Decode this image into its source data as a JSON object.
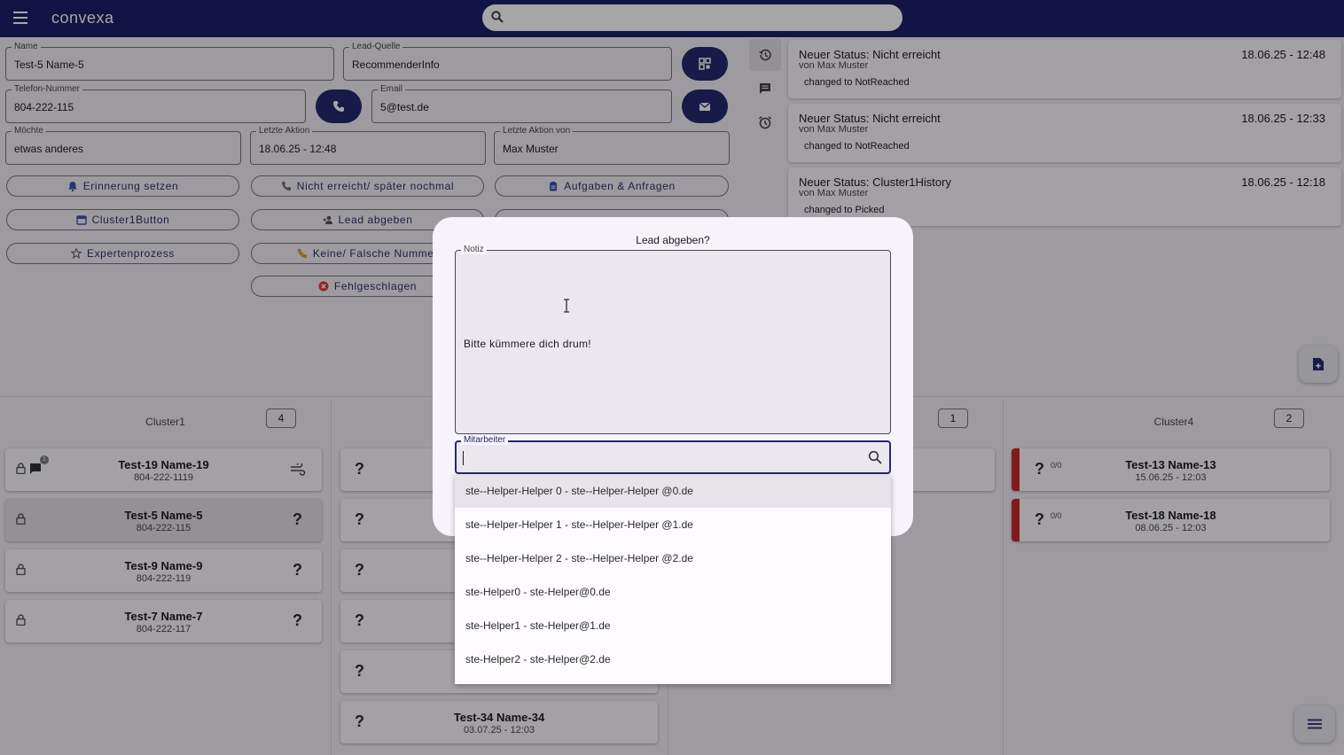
{
  "app": {
    "brand": "convexa"
  },
  "form": {
    "name_label": "Name",
    "name_value": "Test-5 Name-5",
    "source_label": "Lead-Quelle",
    "source_value": "RecommenderInfo",
    "phone_label": "Telefon-Nummer",
    "phone_value": "804-222-115",
    "email_label": "Email",
    "email_value": "5@test.de",
    "wish_label": "Möchte",
    "wish_value": "etwas anderes",
    "last_action_label": "Letzte Aktion",
    "last_action_value": "18.06.25 - 12:48",
    "last_by_label": "Letzte Aktion von",
    "last_by_value": "Max Muster"
  },
  "actions": {
    "reminder": "Erinnerung setzen",
    "not_reached": "Nicht erreicht/ später nochmal",
    "tasks": "Aufgaben & Anfragen",
    "cluster1": "Cluster1Button",
    "handover": "Lead abgeben",
    "expert": "Expertenprozess",
    "wrong_number": "Keine/ Falsche Nummer",
    "failed": "Fehlgeschlagen"
  },
  "history": [
    {
      "title": "Neuer Status: Nicht erreicht",
      "by": "von Max Muster",
      "change": "changed to NotReached",
      "date": "18.06.25 - 12:48"
    },
    {
      "title": "Neuer Status: Nicht erreicht",
      "by": "von Max Muster",
      "change": "changed to NotReached",
      "date": "18.06.25 - 12:33"
    },
    {
      "title": "Neuer Status: Cluster1History",
      "by": "von Max Muster",
      "change": "changed to Picked",
      "date": "18.06.25 - 12:18"
    }
  ],
  "board": {
    "col1": {
      "title": "Cluster1",
      "count": "4",
      "cards": [
        {
          "name": "Test-19 Name-19",
          "sub": "804-222-1119"
        },
        {
          "name": "Test-5 Name-5",
          "sub": "804-222-115"
        },
        {
          "name": "Test-9 Name-9",
          "sub": "804-222-119"
        },
        {
          "name": "Test-7 Name-7",
          "sub": "804-222-117"
        }
      ],
      "chat_badge": "1"
    },
    "col2": {
      "cards": [
        {
          "name": "Test-34 Name-34",
          "sub": "03.07.25 - 12:03"
        }
      ]
    },
    "col3": {
      "count": "1"
    },
    "col4": {
      "title": "Cluster4",
      "count": "2",
      "cards": [
        {
          "name": "Test-13 Name-13",
          "sub": "15.06.25 - 12:03",
          "ratio": "0/0"
        },
        {
          "name": "Test-18 Name-18",
          "sub": "08.06.25 - 12:03",
          "ratio": "0/0"
        }
      ]
    }
  },
  "dialog": {
    "title": "Lead abgeben?",
    "note_label": "Notiz",
    "note_value": "Bitte kümmere dich drum!",
    "employee_label": "Mitarbeiter",
    "options": [
      "ste--Helper-Helper 0 - ste--Helper-Helper @0.de",
      "ste--Helper-Helper 1 - ste--Helper-Helper @1.de",
      "ste--Helper-Helper 2 - ste--Helper-Helper @2.de",
      "ste-Helper0 - ste-Helper@0.de",
      "ste-Helper1 - ste-Helper@1.de",
      "ste-Helper2 - ste-Helper@2.de"
    ]
  },
  "colors": {
    "primary": "#25286f",
    "appbar": "#1d1f6b",
    "danger": "#c62828"
  }
}
